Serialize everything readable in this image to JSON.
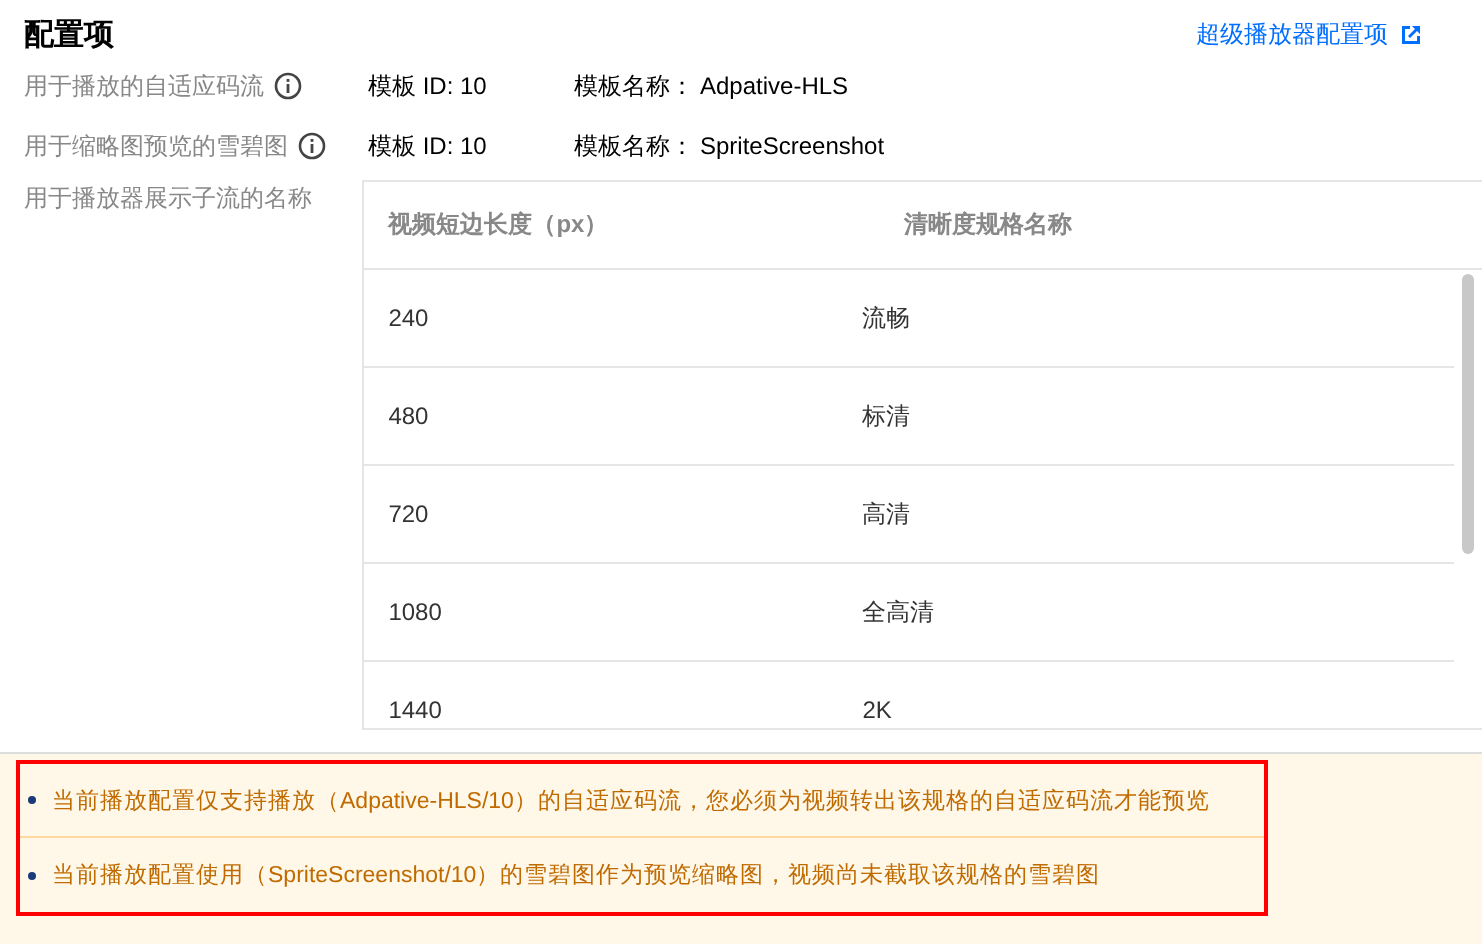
{
  "title": "配置项",
  "link": {
    "label": "超级播放器配置项"
  },
  "settings": [
    {
      "label": "用于播放的自适应码流",
      "template_id": "模板 ID: 10",
      "name_label": "模板名称：",
      "name_value": "Adpative-HLS"
    },
    {
      "label": "用于缩略图预览的雪碧图",
      "template_id": "模板 ID: 10",
      "name_label": "模板名称：",
      "name_value": "SpriteScreenshot"
    }
  ],
  "streams": {
    "label": "用于播放器展示子流的名称",
    "columns": [
      "视频短边长度（px）",
      "清晰度规格名称"
    ],
    "rows": [
      [
        "240",
        "流畅"
      ],
      [
        "480",
        "标清"
      ],
      [
        "720",
        "高清"
      ],
      [
        "1080",
        "全高清"
      ],
      [
        "1440",
        "2K"
      ]
    ]
  },
  "warnings": [
    "当前播放配置仅支持播放（Adpative-HLS/10）的自适应码流，您必须为视频转出该规格的自适应码流才能预览",
    "当前播放配置使用（SpriteScreenshot/10）的雪碧图作为预览缩略图，视频尚未截取该规格的雪碧图"
  ]
}
